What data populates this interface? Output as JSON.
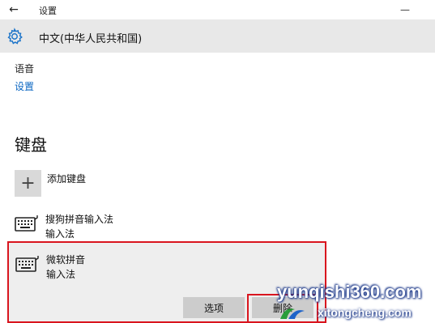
{
  "window": {
    "title": "设置",
    "back_icon": "←",
    "minimize_icon": "—"
  },
  "header": {
    "icon": "gear-icon",
    "title": "中文(中华人民共和国)"
  },
  "speech": {
    "label": "语音",
    "link": "设置"
  },
  "keyboard": {
    "section_title": "键盘",
    "add_label": "添加键盘",
    "add_icon": "+",
    "items": [
      {
        "name": "搜狗拼音输入法",
        "type": "输入法",
        "icon": "keyboard-icon"
      },
      {
        "name": "微软拼音",
        "type": "输入法",
        "icon": "keyboard-icon",
        "selected": true
      }
    ],
    "options_label": "选项",
    "remove_label": "删除"
  },
  "watermark": {
    "main": "yunqishi360.com",
    "sub": "xitongcheng.com"
  },
  "colors": {
    "link": "#0a66c2",
    "highlight": "#d9151e",
    "header_bg": "#e8e8e8",
    "button_bg": "#cccccc"
  }
}
